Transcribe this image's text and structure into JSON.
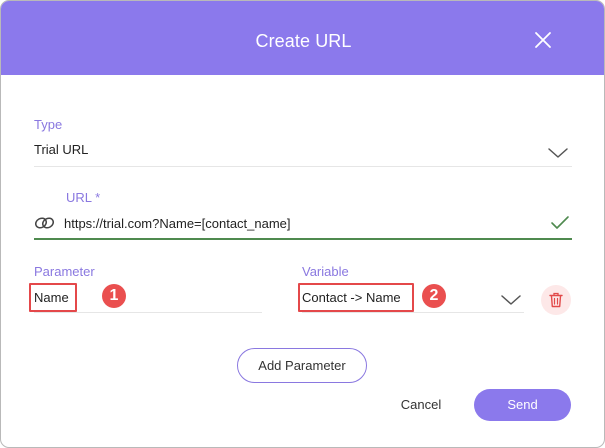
{
  "dialog": {
    "title": "Create URL",
    "close_icon": "close-icon"
  },
  "type_field": {
    "label": "Type",
    "value": "Trial URL",
    "icon": "chevron-down-icon"
  },
  "url_field": {
    "label": "URL *",
    "value": "https://trial.com?Name=[contact_name]",
    "link_icon": "link-icon",
    "valid_icon": "checkmark-icon"
  },
  "parameter_field": {
    "label": "Parameter",
    "value": "Name",
    "badge": "1"
  },
  "variable_field": {
    "label": "Variable",
    "value": "Contact -> Name",
    "badge": "2",
    "icon": "chevron-down-icon"
  },
  "actions": {
    "add_parameter": "Add Parameter",
    "cancel": "Cancel",
    "send": "Send",
    "delete_icon": "trash-icon"
  },
  "colors": {
    "accent": "#8b79ec",
    "label": "#8a78e0",
    "valid": "#4f8a4f",
    "highlight": "#e4484a",
    "delete_bg": "#fde8e8"
  }
}
